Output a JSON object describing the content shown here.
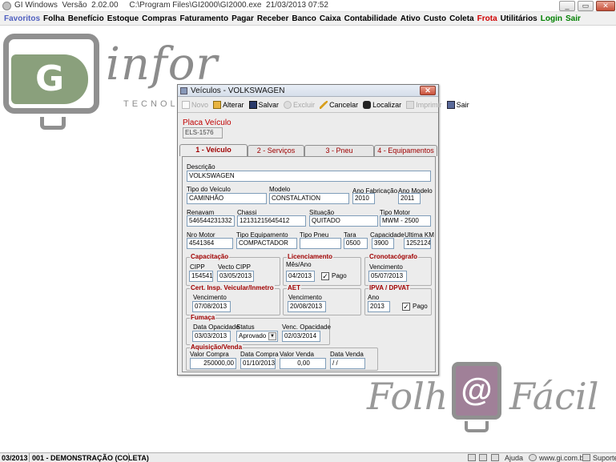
{
  "window": {
    "title": "GI Windows  Versão  2.02.00     C:\\Program Files\\GI2000\\GI2000.exe  21/03/2013 07:52",
    "minimize": "_",
    "restore": "▭",
    "close": "✕"
  },
  "menu": {
    "items": [
      "Favoritos",
      "Folha",
      "Benefício",
      "Estoque",
      "Compras",
      "Faturamento",
      "Pagar",
      "Receber",
      "Banco",
      "Caixa",
      "Contabilidade",
      "Ativo",
      "Custo",
      "Coleta",
      "Frota",
      "Utilitários",
      "Login",
      "Sair"
    ]
  },
  "background": {
    "ginfor_letter": "G",
    "ginfor_brand": "infor",
    "ginfor_tagline": "TECNOLO",
    "folha_left": "Folh",
    "folha_at": "@",
    "folha_right": "Fácil"
  },
  "dialog": {
    "title": "Veículos  -  VOLKSWAGEN",
    "close": "✕",
    "toolbar": {
      "novo": "Novo",
      "alterar": "Alterar",
      "salvar": "Salvar",
      "excluir": "Excluir",
      "cancelar": "Cancelar",
      "localizar": "Localizar",
      "imprimir": "Imprimir",
      "sair": "Sair"
    },
    "placa_label": "Placa Veículo",
    "placa_value": "ELS-1576",
    "tabs": [
      "1 - Veículo",
      "2 - Serviços",
      "3 - Pneu",
      "4 - Equipamentos"
    ],
    "fields": {
      "descricao_label": "Descrição",
      "descricao": "VOLKSWAGEN",
      "tipo_veiculo_label": "Tipo do Veículo",
      "tipo_veiculo": "CAMINHÃO",
      "modelo_label": "Modelo",
      "modelo": "CONSTALATION",
      "ano_fab_label": "Ano Fabricação",
      "ano_fab": "2010",
      "ano_modelo_label": "Ano Modelo",
      "ano_modelo": "2011",
      "renavam_label": "Renavam",
      "renavam": "546544231332",
      "chassi_label": "Chassi",
      "chassi": "12131215645412",
      "situacao_label": "Situação",
      "situacao": "QUITADO",
      "tipo_motor_label": "Tipo Motor",
      "tipo_motor": "MWM - 2500",
      "nro_motor_label": "Nro Motor",
      "nro_motor": "4541364",
      "tipo_equip_label": "Tipo Equipamento",
      "tipo_equip": "COMPACTADOR",
      "tipo_pneu_label": "Tipo Pneu",
      "tipo_pneu": "",
      "tara_label": "Tara",
      "tara": "0500",
      "capacidade_label": "Capacidade",
      "capacidade": "3900",
      "ultima_km_label": "Ultima KM",
      "ultima_km": "1252124"
    },
    "capacitacao": {
      "title": "Capacitação",
      "cipp_label": "CIPP",
      "cipp": "154541",
      "vecto_label": "Vecto CIPP",
      "vecto": "03/05/2013"
    },
    "licenciamento": {
      "title": "Licenciamento",
      "mes_ano_label": "Mês/Ano",
      "mes_ano": "04/2013",
      "pago_label": "Pago",
      "pago_check": "✓"
    },
    "cronotacografo": {
      "title": "Cronotacógrafo",
      "venc_label": "Vencimento",
      "venc": "05/07/2013"
    },
    "cert_insp": {
      "title": "Cert. Insp. Veicular/Inmetro",
      "venc_label": "Vencimento",
      "venc": "07/08/2013"
    },
    "aet": {
      "title": "AET",
      "venc_label": "Vencimento",
      "venc": "20/08/2013"
    },
    "ipva": {
      "title": "IPVA / DPVAT",
      "ano_label": "Ano",
      "ano": "2013",
      "pago_label": "Pago",
      "pago_check": "✓"
    },
    "fumaca": {
      "title": "Fumaça",
      "data_label": "Data Opacidade",
      "data": "03/03/2013",
      "status_label": "Status",
      "status": "Aprovado",
      "venc_label": "Venc. Opacidade",
      "venc": "02/03/2014"
    },
    "aquisicao": {
      "title": "Aquisição/Venda",
      "valor_compra_label": "Valor Compra",
      "valor_compra": "250000,00",
      "data_compra_label": "Data Compra",
      "data_compra": "01/10/2013",
      "valor_venda_label": "Valor Venda",
      "valor_venda": "0,00",
      "data_venda_label": "Data Venda",
      "data_venda": " / /"
    }
  },
  "status": {
    "date": "03/2013",
    "company": "001 - DEMONSTRAÇÃO (COLETA)",
    "ajuda": "Ajuda",
    "site": "www.gi.com.br",
    "suporte": "Suporte"
  },
  "colors": {
    "accent_red": "#c00000",
    "favoritos": "#5060c0",
    "frota": "#d00000",
    "login_sair": "#008000",
    "ginfor_green": "#8aa07c",
    "folha_purple": "#a08098"
  }
}
